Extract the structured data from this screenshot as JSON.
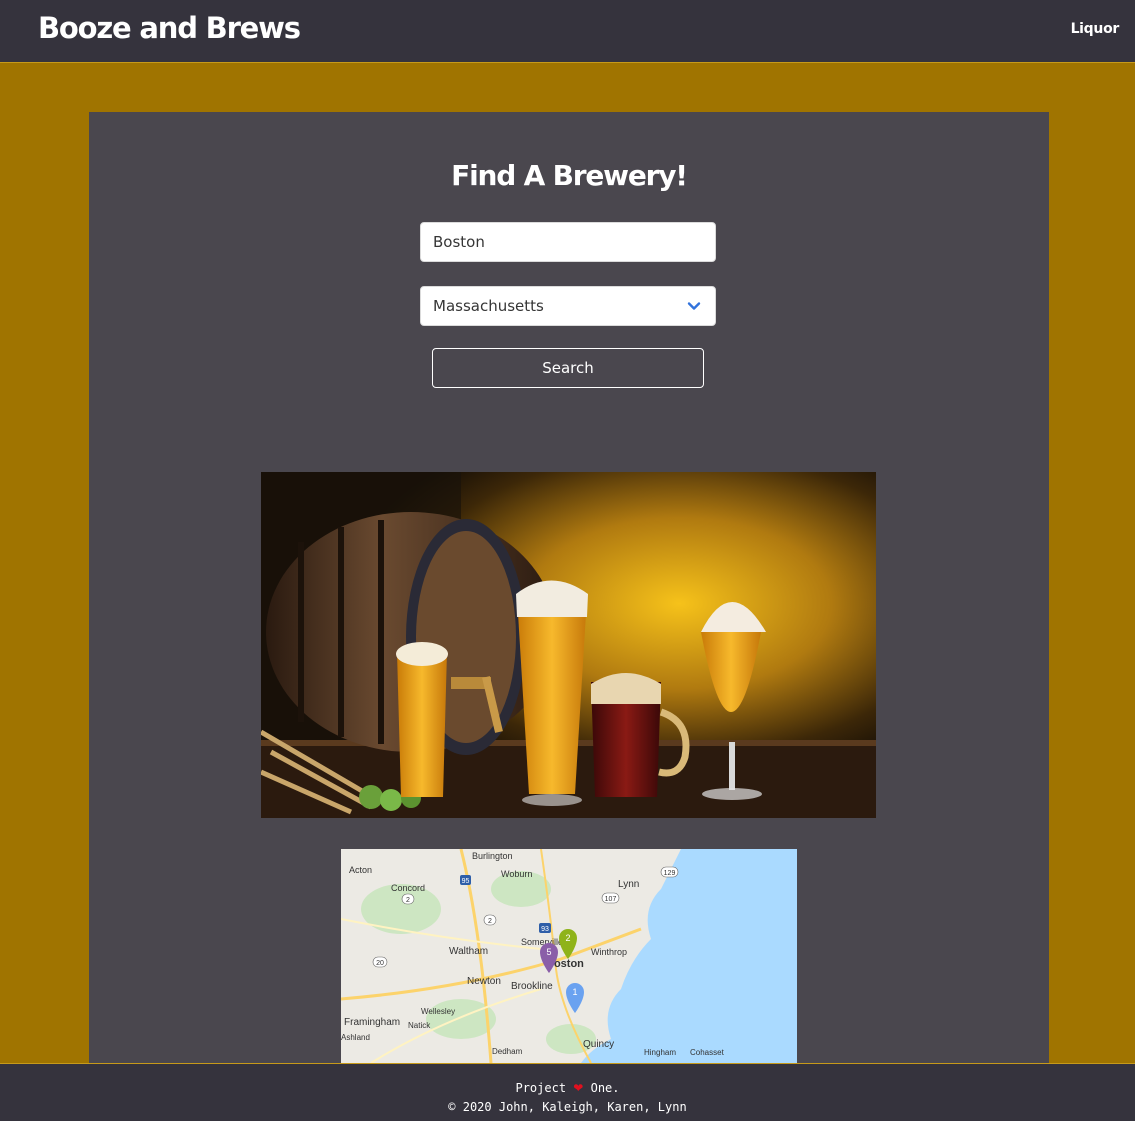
{
  "navbar": {
    "brand": "Booze and Brews",
    "link_label": "Liquor"
  },
  "search": {
    "title": "Find A Brewery!",
    "city_value": "Boston",
    "state_value": "Massachusetts",
    "button_label": "Search"
  },
  "map": {
    "labels": [
      "Burlington",
      "Acton",
      "Concord",
      "Woburn",
      "Lynn",
      "Waltham",
      "Somerville",
      "Boston",
      "Winthrop",
      "Newton",
      "Brookline",
      "Wellesley",
      "Framingham",
      "Natick",
      "Ashland",
      "Dedham",
      "Quincy",
      "Hingham",
      "Cohasset"
    ],
    "markers": [
      "1",
      "2",
      "5"
    ],
    "highway_shields": [
      "95",
      "2",
      "2",
      "20",
      "129",
      "107",
      "93"
    ]
  },
  "footer": {
    "line1_prefix": "Project",
    "heart": "❤",
    "line1_suffix": "One.",
    "line2": "© 2020 John, Kaleigh, Karen, Lynn"
  },
  "colors": {
    "page_background": "#a07400",
    "navbar_background": "#35333d",
    "panel_background": "#4a474e",
    "accent_border": "#c79a1a"
  }
}
